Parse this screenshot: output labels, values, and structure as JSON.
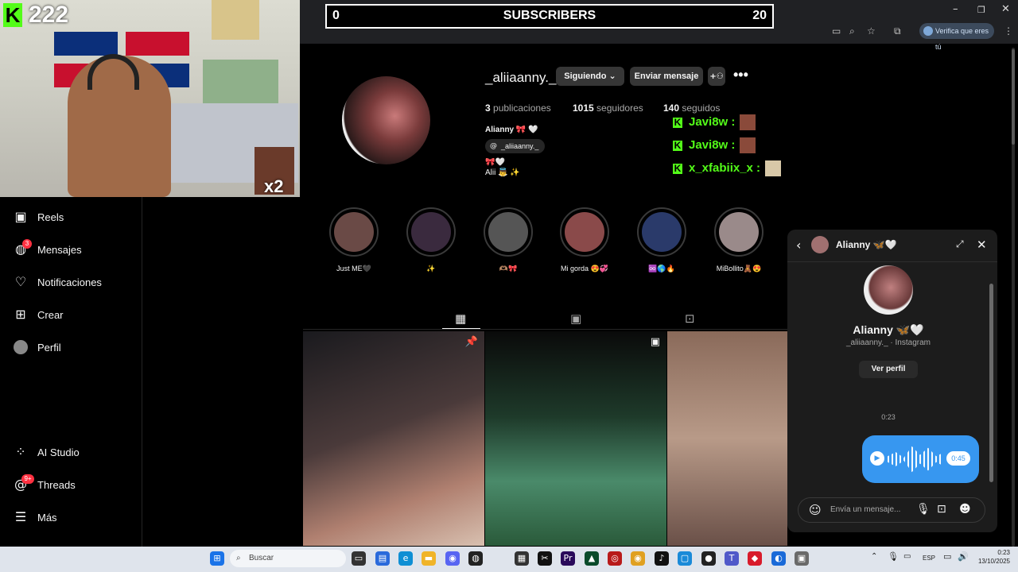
{
  "overlay": {
    "kick_count": "222",
    "subscribers_left": "0",
    "subscribers_label": "SUBSCRIBERS",
    "subscribers_right": "20",
    "multiplier": "x2",
    "kick_chat": [
      {
        "user": "Javi8w :"
      },
      {
        "user": "Javi8w :"
      },
      {
        "user": "x_xfabiix_x :"
      }
    ]
  },
  "browser": {
    "verify_label": "Verifica que eres tú"
  },
  "sidebar": {
    "items": [
      {
        "label": "Reels",
        "icon": "reels-icon"
      },
      {
        "label": "Mensajes",
        "icon": "messenger-icon",
        "badge": "3"
      },
      {
        "label": "Notificaciones",
        "icon": "heart-icon"
      },
      {
        "label": "Crear",
        "icon": "plus-square-icon"
      },
      {
        "label": "Perfil",
        "icon": "profile-avatar"
      }
    ],
    "bottom_items": [
      {
        "label": "AI Studio",
        "icon": "ai-studio-icon"
      },
      {
        "label": "Threads",
        "icon": "threads-icon",
        "badge": "9+"
      },
      {
        "label": "Más",
        "icon": "menu-icon"
      }
    ]
  },
  "profile": {
    "username": "_aliiaanny._",
    "following_label": "Siguiendo",
    "message_label": "Enviar mensaje",
    "posts_count": "3",
    "posts_label": "publicaciones",
    "followers_count": "1015",
    "followers_label": "seguidores",
    "following_count": "140",
    "following_count_label": "seguidos",
    "display_name": "Alianny 🎀 🤍",
    "threads_handle": "_aliiaanny._",
    "bio_line1": "🎀🤍",
    "bio_line2": "Alii 👼 ✨"
  },
  "highlights": [
    {
      "label": "Just ME🖤",
      "color": "#6a4a46"
    },
    {
      "label": "✨",
      "color": "#3a2a3e"
    },
    {
      "label": "🫶🏽🎀",
      "color": "#555"
    },
    {
      "label": "Mi gorda 😍💞",
      "color": "#8a4a4a"
    },
    {
      "label": "♾️🌎🔥",
      "color": "#2a3a6a"
    },
    {
      "label": "MiBollito🧸😍",
      "color": "#9a8a8a"
    }
  ],
  "posts": [
    {
      "bg": "#4a3a3a"
    },
    {
      "bg": "#2a5a3a"
    },
    {
      "bg": "#8a6a5a"
    }
  ],
  "chat": {
    "title": "Alianny 🦋🤍",
    "name": "Alianny 🦋🤍",
    "subtitle": "_aliiaanny._ · Instagram",
    "view_profile": "Ver perfil",
    "timestamp": "0:23",
    "voice_duration": "0:45",
    "input_placeholder": "Envía un mensaje..."
  },
  "taskbar": {
    "search_placeholder": "Buscar",
    "lang": "ESP",
    "time": "0:23",
    "date": "13/10/2025"
  }
}
